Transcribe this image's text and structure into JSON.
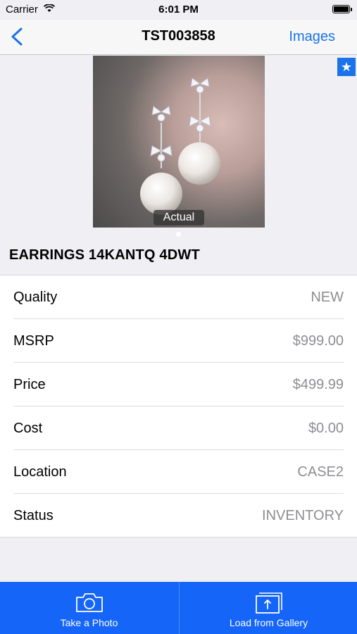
{
  "status_bar": {
    "carrier": "Carrier",
    "time": "6:01 PM"
  },
  "nav": {
    "title": "TST003858",
    "right_button": "Images",
    "back_icon": "chevron-left-icon"
  },
  "gallery": {
    "caption": "Actual",
    "favorite_icon": "star-icon",
    "page_count": 1,
    "current_page": 1
  },
  "item": {
    "title": "EARRINGS 14KANTQ 4DWT",
    "details": [
      {
        "label": "Quality",
        "value": "NEW"
      },
      {
        "label": "MSRP",
        "value": "$999.00"
      },
      {
        "label": "Price",
        "value": "$499.99"
      },
      {
        "label": "Cost",
        "value": "$0.00"
      },
      {
        "label": "Location",
        "value": "CASE2"
      },
      {
        "label": "Status",
        "value": "INVENTORY"
      }
    ]
  },
  "tab_bar": {
    "take_photo": {
      "label": "Take a Photo",
      "icon": "camera-icon"
    },
    "load_gallery": {
      "label": "Load from Gallery",
      "icon": "upload-gallery-icon"
    }
  },
  "colors": {
    "accent": "#1a73e8",
    "tab_bar": "#1565f8",
    "background": "#efeff4"
  }
}
